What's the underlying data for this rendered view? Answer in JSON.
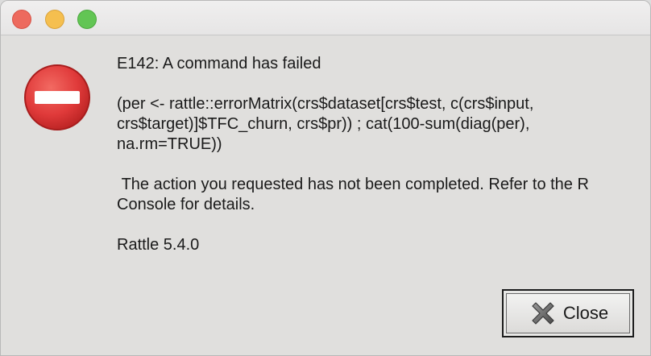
{
  "dialog": {
    "heading": "E142: A command has failed",
    "command": "(per <- rattle::errorMatrix(crs$dataset[crs$test, c(crs$input, crs$target)]$TFC_churn, crs$pr)) ; cat(100-sum(diag(per), na.rm=TRUE))",
    "message": " The action you requested has not been completed. Refer to the R Console for details.",
    "version": "Rattle 5.4.0"
  },
  "buttons": {
    "close_label": "Close"
  },
  "icons": {
    "dialog_icon": "error-stop-icon",
    "button_icon": "x-mark-icon"
  },
  "colors": {
    "error_red": "#e03a3a",
    "window_close": "#ed6a5e",
    "window_minimize": "#f5bf4f",
    "window_zoom": "#62c554"
  }
}
